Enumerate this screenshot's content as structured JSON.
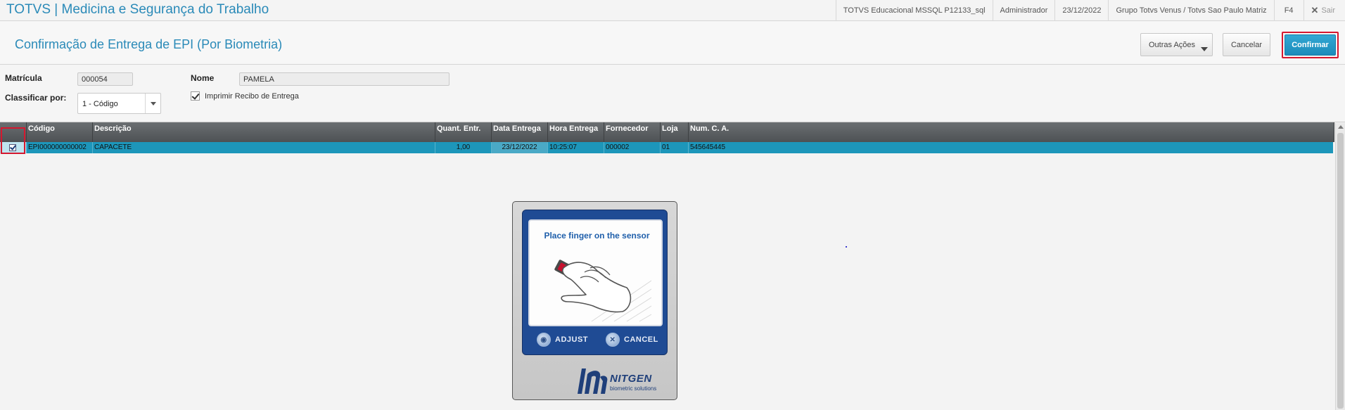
{
  "app": {
    "title": "TOTVS | Medicina e Segurança do Trabalho",
    "environment": "TOTVS Educacional MSSQL P12133_sql",
    "user": "Administrador",
    "date": "23/12/2022",
    "branch": "Grupo Totvs Venus / Totvs Sao Paulo Matriz",
    "shortcut": "F4",
    "exit_label": "Sair"
  },
  "header": {
    "page_title": "Confirmação de Entrega de EPI (Por Biometria)",
    "buttons": {
      "other_actions": "Outras Ações",
      "cancel": "Cancelar",
      "confirm": "Confirmar"
    }
  },
  "form": {
    "matricula_label": "Matrícula",
    "matricula_value": "000054",
    "nome_label": "Nome",
    "nome_value": "PAMELA",
    "classificar_label": "Classificar por:",
    "classificar_value": "1 - Código",
    "print_receipt_label": "Imprimir Recibo de Entrega",
    "print_receipt_checked": true
  },
  "grid": {
    "columns": [
      "Código",
      "Descrição",
      "Quant. Entr.",
      "Data Entrega",
      "Hora Entrega",
      "Fornecedor",
      "Loja",
      "Num. C. A."
    ],
    "rows": [
      {
        "selected": true,
        "codigo": "EPI000000000002",
        "descricao": "CAPACETE",
        "quant": "1,00",
        "data": "23/12/2022",
        "hora": "10:25:07",
        "fornecedor": "000002",
        "loja": "01",
        "num_ca": "545645445"
      }
    ]
  },
  "biometric": {
    "prompt": "Place finger on the sensor",
    "adjust_label": "ADJUST",
    "cancel_label": "CANCEL",
    "brand_name": "NITGEN",
    "brand_tagline": "biometric solutions"
  },
  "colors": {
    "accent": "#2a8ab8",
    "confirm_button": "#1c8bbb",
    "highlight_row": "#1d96ba",
    "annotation_red": "#d5182f",
    "device_blue": "#1f4b94"
  }
}
